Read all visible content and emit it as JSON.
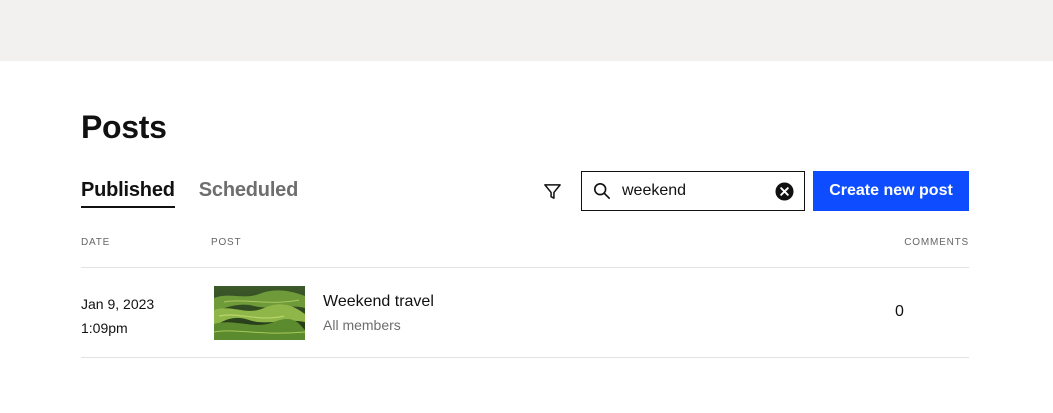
{
  "page": {
    "title": "Posts"
  },
  "tabs": [
    {
      "label": "Published",
      "active": true
    },
    {
      "label": "Scheduled",
      "active": false
    }
  ],
  "toolbar": {
    "filter_icon": "filter-icon",
    "search": {
      "value": "weekend",
      "icon": "search-icon",
      "clear_icon": "clear-circle-icon"
    },
    "create_label": "Create new post"
  },
  "table": {
    "columns": {
      "date": "DATE",
      "post": "POST",
      "comments": "COMMENTS"
    },
    "rows": [
      {
        "date": "Jan 9, 2023",
        "time": "1:09pm",
        "title": "Weekend travel",
        "visibility": "All members",
        "comments": "0"
      }
    ]
  },
  "colors": {
    "accent": "#0d4dff",
    "top_band": "#f2f1ef"
  }
}
